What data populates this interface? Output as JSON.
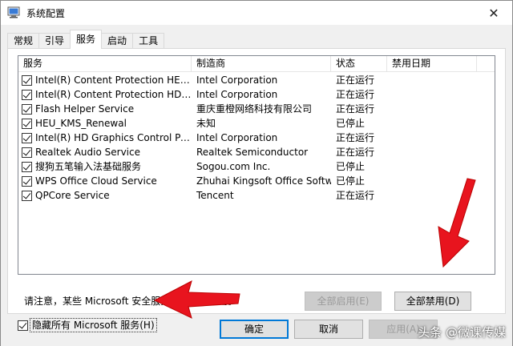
{
  "window": {
    "title": "系统配置",
    "close_glyph": "✕"
  },
  "tabs": [
    {
      "label": "常规"
    },
    {
      "label": "引导"
    },
    {
      "label": "服务"
    },
    {
      "label": "启动"
    },
    {
      "label": "工具"
    }
  ],
  "active_tab": "服务",
  "table": {
    "headers": [
      "服务",
      "制造商",
      "状态",
      "禁用日期"
    ],
    "rows": [
      {
        "checked": true,
        "service": "Intel(R) Content Protection HECI S...",
        "maker": "Intel Corporation",
        "status": "正在运行"
      },
      {
        "checked": true,
        "service": "Intel(R) Content Protection HDCP ...",
        "maker": "Intel Corporation",
        "status": "正在运行"
      },
      {
        "checked": true,
        "service": "Flash Helper Service",
        "maker": "重庆重橙网络科技有限公司",
        "status": "正在运行"
      },
      {
        "checked": true,
        "service": "HEU_KMS_Renewal",
        "maker": "未知",
        "status": "已停止"
      },
      {
        "checked": true,
        "service": "Intel(R) HD Graphics Control Panel ...",
        "maker": "Intel Corporation",
        "status": "正在运行"
      },
      {
        "checked": true,
        "service": "Realtek Audio Service",
        "maker": "Realtek Semiconductor",
        "status": "正在运行"
      },
      {
        "checked": true,
        "service": "搜狗五笔输入法基础服务",
        "maker": "Sogou.com Inc.",
        "status": "已停止"
      },
      {
        "checked": true,
        "service": "WPS Office Cloud Service",
        "maker": "Zhuhai Kingsoft Office Softw...",
        "status": "已停止"
      },
      {
        "checked": true,
        "service": "QPCore Service",
        "maker": "Tencent",
        "status": "正在运行"
      }
    ]
  },
  "notice": "请注意，某些 Microsoft 安全服务可能无法禁用。",
  "buttons": {
    "enable_all": "全部启用(E)",
    "disable_all": "全部禁用(D)",
    "ok": "确定",
    "cancel": "取消",
    "apply": "应用(A)"
  },
  "hide_ms": {
    "checked": true,
    "label": "隐藏所有 Microsoft 服务(H)"
  },
  "watermark": "头条 @微课传媒",
  "colors": {
    "arrow_red": "#e8141e",
    "focus_blue": "#0078d7"
  }
}
